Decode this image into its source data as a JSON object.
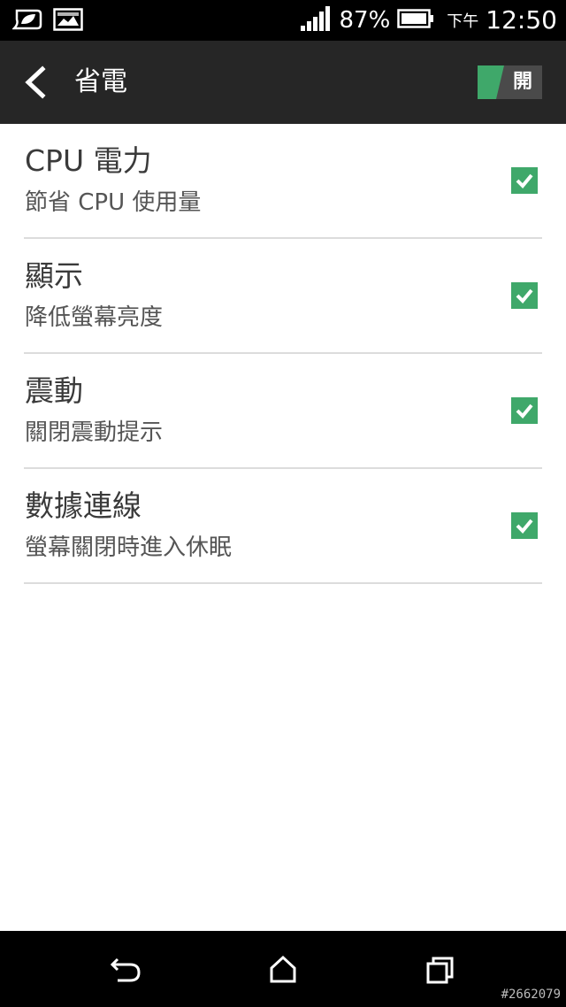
{
  "status_bar": {
    "battery_percent": "87%",
    "time_prefix": "下午",
    "time": "12:50",
    "icons": [
      "leaf-battery-saver-icon",
      "image-notification-icon",
      "signal-strength-icon",
      "battery-icon"
    ]
  },
  "app_bar": {
    "back_icon": "chevron-left-icon",
    "title": "省電",
    "master_toggle_label": "開",
    "master_toggle_on": true
  },
  "settings": [
    {
      "title": "CPU 電力",
      "subtitle": "節省 CPU 使用量",
      "checked": true
    },
    {
      "title": "顯示",
      "subtitle": "降低螢幕亮度",
      "checked": true
    },
    {
      "title": "震動",
      "subtitle": "關閉震動提示",
      "checked": true
    },
    {
      "title": "數據連線",
      "subtitle": "螢幕關閉時進入休眠",
      "checked": true
    }
  ],
  "nav_bar": {
    "icons": [
      "back-icon",
      "home-icon",
      "recent-apps-icon"
    ]
  },
  "watermark": "#2662079",
  "colors": {
    "accent": "#3fa86a",
    "app_bar": "#262626",
    "status_bar": "#000000"
  }
}
